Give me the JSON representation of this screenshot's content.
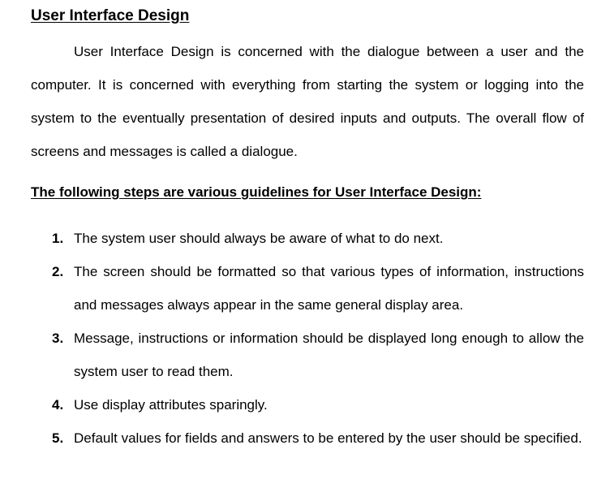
{
  "document": {
    "title": "User Interface Design",
    "intro": "User Interface Design is concerned with the dialogue between a user and the computer. It is concerned with everything from starting the system or logging into the system to the eventually presentation of desired inputs and outputs. The overall flow of screens and messages is called a dialogue.",
    "subheading": "The following steps are various guidelines for User Interface Design:",
    "steps": [
      {
        "number": "1.",
        "text": "The system user should always be aware of what to do next."
      },
      {
        "number": "2.",
        "text": "The screen should be formatted so that various types of information, instructions and messages always appear in the same general display area."
      },
      {
        "number": "3.",
        "text": "Message, instructions or information should be displayed long enough to allow the system user to read them."
      },
      {
        "number": "4.",
        "text": "Use display attributes sparingly."
      },
      {
        "number": "5.",
        "text": "Default values for fields and answers to be entered by the user should be specified."
      }
    ]
  }
}
